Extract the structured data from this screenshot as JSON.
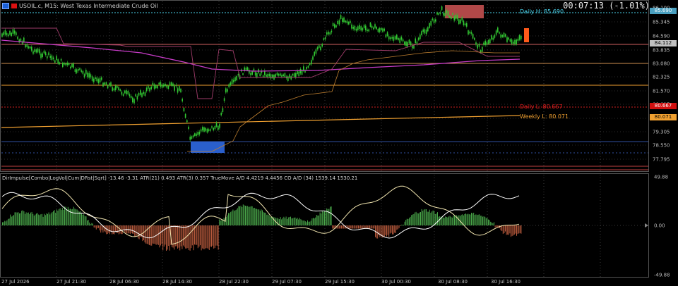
{
  "header": {
    "symbol": "USOIL.c, M15:  West Texas Intermediate Crude Oil",
    "timer": "00:07:13 (-1.01%)"
  },
  "main_axis": {
    "prices": [
      "86.100",
      "85.345",
      "84.590",
      "83.835",
      "83.080",
      "82.325",
      "81.570",
      "80.815",
      "80.060",
      "79.305",
      "78.550",
      "77.795"
    ],
    "tags": [
      {
        "text": "85.690",
        "bg": "#4aa0c0",
        "fg": "#ffffff"
      },
      {
        "text": "84.112",
        "bg": "#c0c0c0",
        "fg": "#000000"
      },
      {
        "text": "80.667",
        "bg": "#d01010",
        "fg": "#ffffff"
      },
      {
        "text": "80.071",
        "bg": "#f0a030",
        "fg": "#000000"
      }
    ]
  },
  "levels": {
    "daily_high": "Daily H: 85.690",
    "daily_low": "Daily L: 80.667",
    "weekly_low": "Weekly L: 80.071"
  },
  "indicator": {
    "title": "DirImpulse[Combo|LogVol|Cum|DRst|Sqrt] -13.46 -3.31 ATR(21) 0.493 ATR(3) 0.357 TrueMove A/D 4.4219 4.4456 CO A/D (34) 1539.14 1530.21",
    "axis": [
      "49.88",
      "0.00",
      "-49.88"
    ]
  },
  "time_axis": [
    "27 Jul 2026",
    "27 Jul 21:30",
    "28 Jul 06:30",
    "28 Jul 14:30",
    "28 Jul 22:30",
    "29 Jul 07:30",
    "29 Jul 15:30",
    "30 Jul 00:30",
    "30 Jul 08:30",
    "30 Jul 16:30"
  ],
  "colors": {
    "bull": "#32c832",
    "bear": "#32c832",
    "accent_magenta": "#c83cc8",
    "orange": "#f0a030",
    "red_line": "#d02020",
    "cyan": "#4ad0e8",
    "blue_box": "#2a5fcc",
    "salmon_box": "#d06060"
  }
}
